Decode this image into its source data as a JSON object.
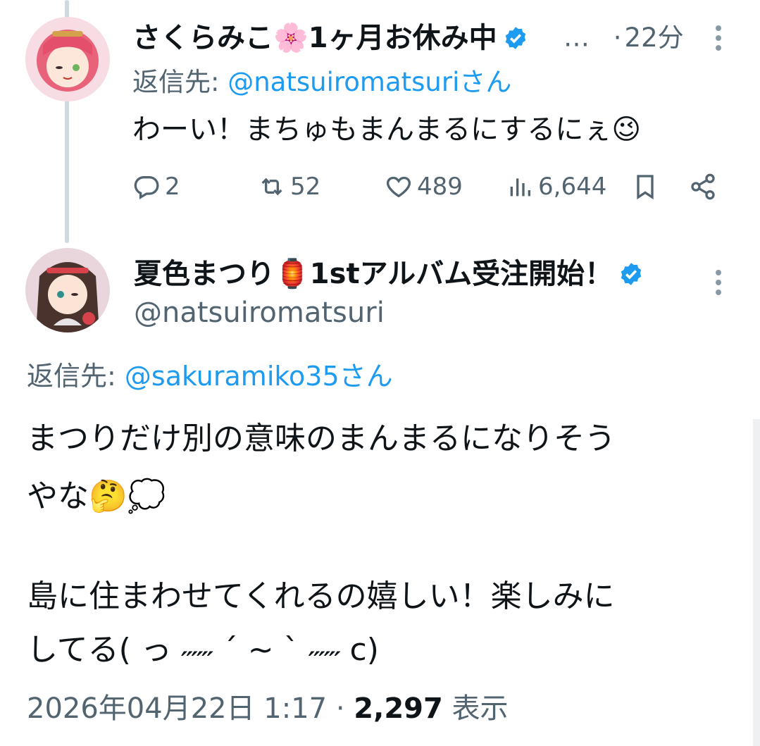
{
  "reply_tweet": {
    "display_name": "さくらみこ🌸1ヶ月お休み中",
    "ellipsis": "…",
    "time_sep": "·",
    "time_ago": "22分",
    "reply_prefix": "返信先: ",
    "reply_handle": "@natsuiromatsuriさん",
    "text": "わーい！まちゅもまんまるにするにぇ😉",
    "actions": {
      "replies": "2",
      "retweets": "52",
      "likes": "489",
      "views": "6,644"
    }
  },
  "main_tweet": {
    "display_name": "夏色まつり🏮1stアルバム受注開始！",
    "handle": "@natsuiromatsuri",
    "reply_prefix": "返信先: ",
    "reply_handle": "@sakuramiko35さん",
    "text_line1": "まつりだけ別の意味のまんまるになりそう",
    "text_line2": "やな🤔💭",
    "text_line3": "島に住まわせてくれるの嬉しい！楽しみに",
    "text_line4": "してる( っ ˶˶˶ ˊ ~ ˋ ˶˶˶ c)",
    "timestamp": "2026年04月22日 1:17",
    "dot": " · ",
    "view_count": "2,297",
    "view_label": " 表示"
  },
  "colors": {
    "link": "#1d9bf0",
    "muted": "#536471",
    "text": "#0f1419",
    "thread_line": "#cfd9de"
  },
  "icons": [
    "verified-badge-icon",
    "more-options-icon",
    "reply-icon",
    "retweet-icon",
    "like-icon",
    "views-icon",
    "bookmark-icon",
    "share-icon"
  ]
}
